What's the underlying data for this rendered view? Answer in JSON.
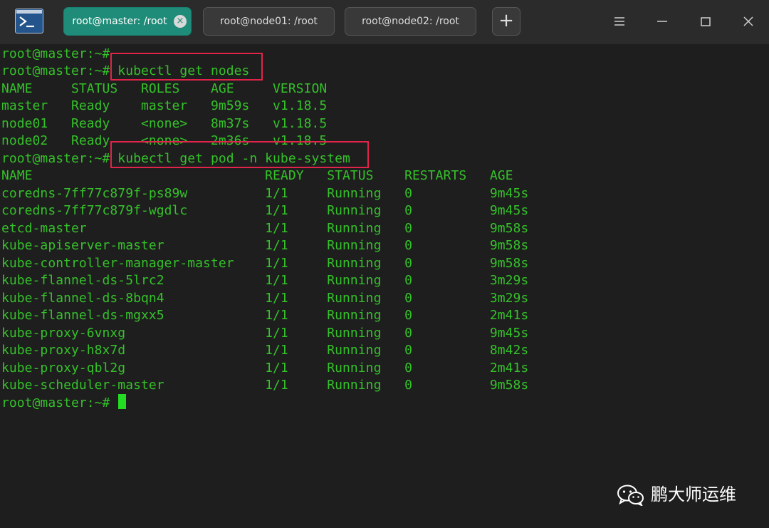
{
  "tabs": [
    {
      "label": "root@master: /root",
      "active": true
    },
    {
      "label": "root@node01: /root",
      "active": false
    },
    {
      "label": "root@node02: /root",
      "active": false
    }
  ],
  "tab_close_glyph": "×",
  "new_tab_glyph": "+",
  "terminal": {
    "lines": [
      "root@master:~#",
      "root@master:~# kubectl get nodes",
      "NAME     STATUS   ROLES    AGE     VERSION",
      "master   Ready    master   9m59s   v1.18.5",
      "node01   Ready    <none>   8m37s   v1.18.5",
      "node02   Ready    <none>   2m36s   v1.18.5",
      "root@master:~# kubectl get pod -n kube-system",
      "NAME                              READY   STATUS    RESTARTS   AGE",
      "coredns-7ff77c879f-ps89w          1/1     Running   0          9m45s",
      "coredns-7ff77c879f-wgdlc          1/1     Running   0          9m45s",
      "etcd-master                       1/1     Running   0          9m58s",
      "kube-apiserver-master             1/1     Running   0          9m58s",
      "kube-controller-manager-master    1/1     Running   0          9m58s",
      "kube-flannel-ds-5lrc2             1/1     Running   0          3m29s",
      "kube-flannel-ds-8bqn4             1/1     Running   0          3m29s",
      "kube-flannel-ds-mgxx5             1/1     Running   0          2m41s",
      "kube-proxy-6vnxg                  1/1     Running   0          9m45s",
      "kube-proxy-h8x7d                  1/1     Running   0          8m42s",
      "kube-proxy-qbl2g                  1/1     Running   0          2m41s",
      "kube-scheduler-master             1/1     Running   0          9m58s",
      "root@master:~# "
    ]
  },
  "watermark": {
    "text": "鹏大师运维",
    "icon": "wechat-icon"
  },
  "colors": {
    "terminal_text": "#35c12a",
    "terminal_bg": "#1e1e1e",
    "active_tab": "#1e8c78",
    "highlight_box": "#e0244a",
    "cursor": "#22dd22"
  }
}
